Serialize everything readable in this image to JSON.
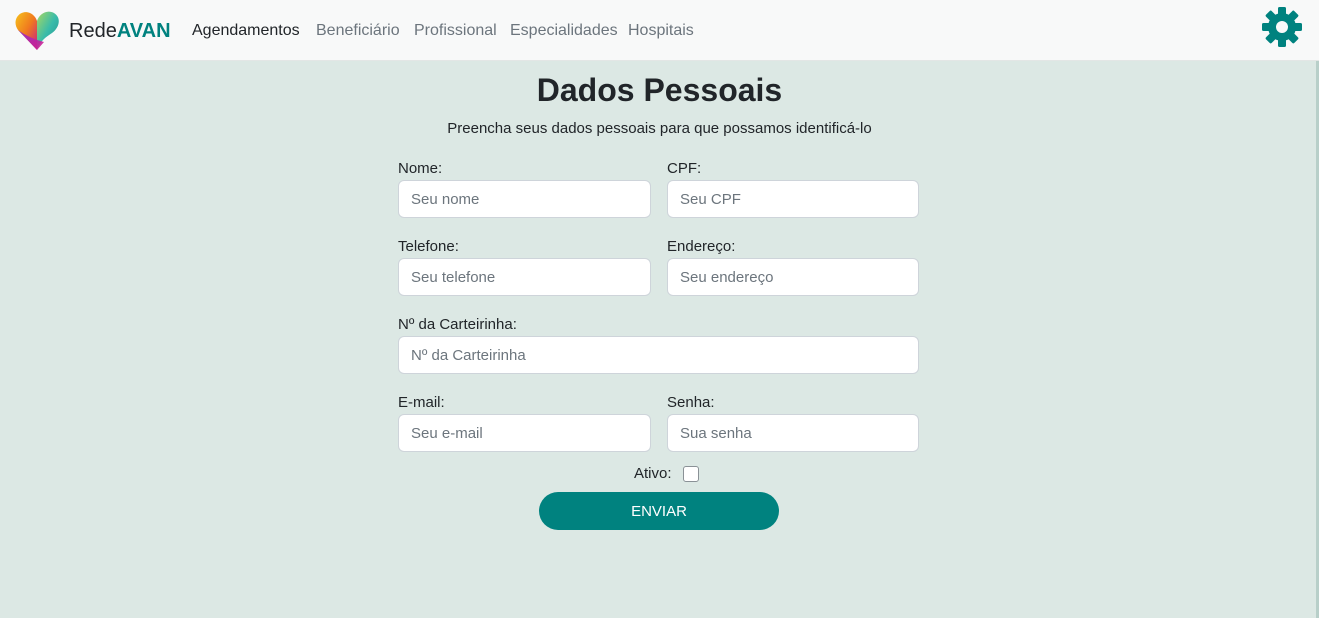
{
  "navbar": {
    "brand_prefix": "Rede",
    "brand_suffix": "AVAN",
    "links": [
      {
        "label": "Agendamentos"
      },
      {
        "label": "Beneficiário"
      },
      {
        "label": "Profissional"
      },
      {
        "label": "Especialidades"
      },
      {
        "label": "Hospitais"
      }
    ],
    "active_index": 0,
    "settings_icon": "gear-icon",
    "logo_icon": "heart-logo-icon"
  },
  "form": {
    "title": "Dados Pessoais",
    "subtitle": "Preencha seus dados pessoais para que possamos identificá-lo",
    "fields": {
      "nome": {
        "label": "Nome:",
        "placeholder": "Seu nome",
        "value": ""
      },
      "cpf": {
        "label": "CPF:",
        "placeholder": "Seu CPF",
        "value": ""
      },
      "telefone": {
        "label": "Telefone:",
        "placeholder": "Seu telefone",
        "value": ""
      },
      "endereco": {
        "label": "Endereço:",
        "placeholder": "Seu endereço",
        "value": ""
      },
      "carteirinha": {
        "label": "Nº da Carteirinha:",
        "placeholder": "Nº da Carteirinha",
        "value": ""
      },
      "email": {
        "label": "E-mail:",
        "placeholder": "Seu e-mail",
        "value": ""
      },
      "senha": {
        "label": "Senha:",
        "placeholder": "Sua senha",
        "value": ""
      }
    },
    "ativo": {
      "label": "Ativo:",
      "checked": false
    },
    "submit_label": "ENVIAR"
  },
  "colors": {
    "accent": "#00827f",
    "page_background": "#dce8e4",
    "navbar_background": "#f8f9f9"
  }
}
